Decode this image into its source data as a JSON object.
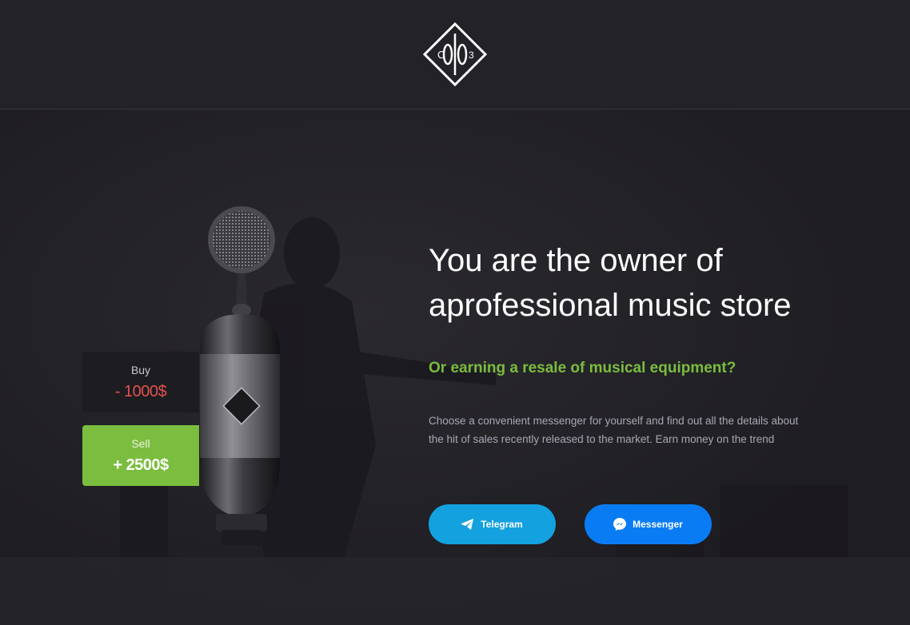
{
  "header": {
    "logo_icon": "diamond-monogram-logo",
    "logo_letters": [
      "C",
      "O",
      "H",
      "O",
      "3"
    ]
  },
  "price_cards": {
    "buy": {
      "label": "Buy",
      "value": "- 1000$",
      "color": "#e0534f"
    },
    "sell": {
      "label": "Sell",
      "value": "+ 2500$",
      "color": "#7bbd3e"
    }
  },
  "hero": {
    "headline_line1": "You are the owner of",
    "headline_line2": "aprofessional music store",
    "subheadline": "Or earning a resale of musical equipment?",
    "description_line1": "Choose a convenient messenger for yourself and find out all the details about",
    "description_line2": "the hit of sales recently released to the market. Earn money on the trend"
  },
  "buttons": {
    "telegram": {
      "label": "Telegram",
      "icon": "paper-plane-icon",
      "color": "#13a1e0"
    },
    "messenger": {
      "label": "Messenger",
      "icon": "messenger-icon",
      "color": "#0a7cf3"
    }
  },
  "colors": {
    "background": "#222126",
    "accent_green": "#7bbd3e",
    "headline": "#ffffff",
    "body_text": "#a9a8b3"
  }
}
